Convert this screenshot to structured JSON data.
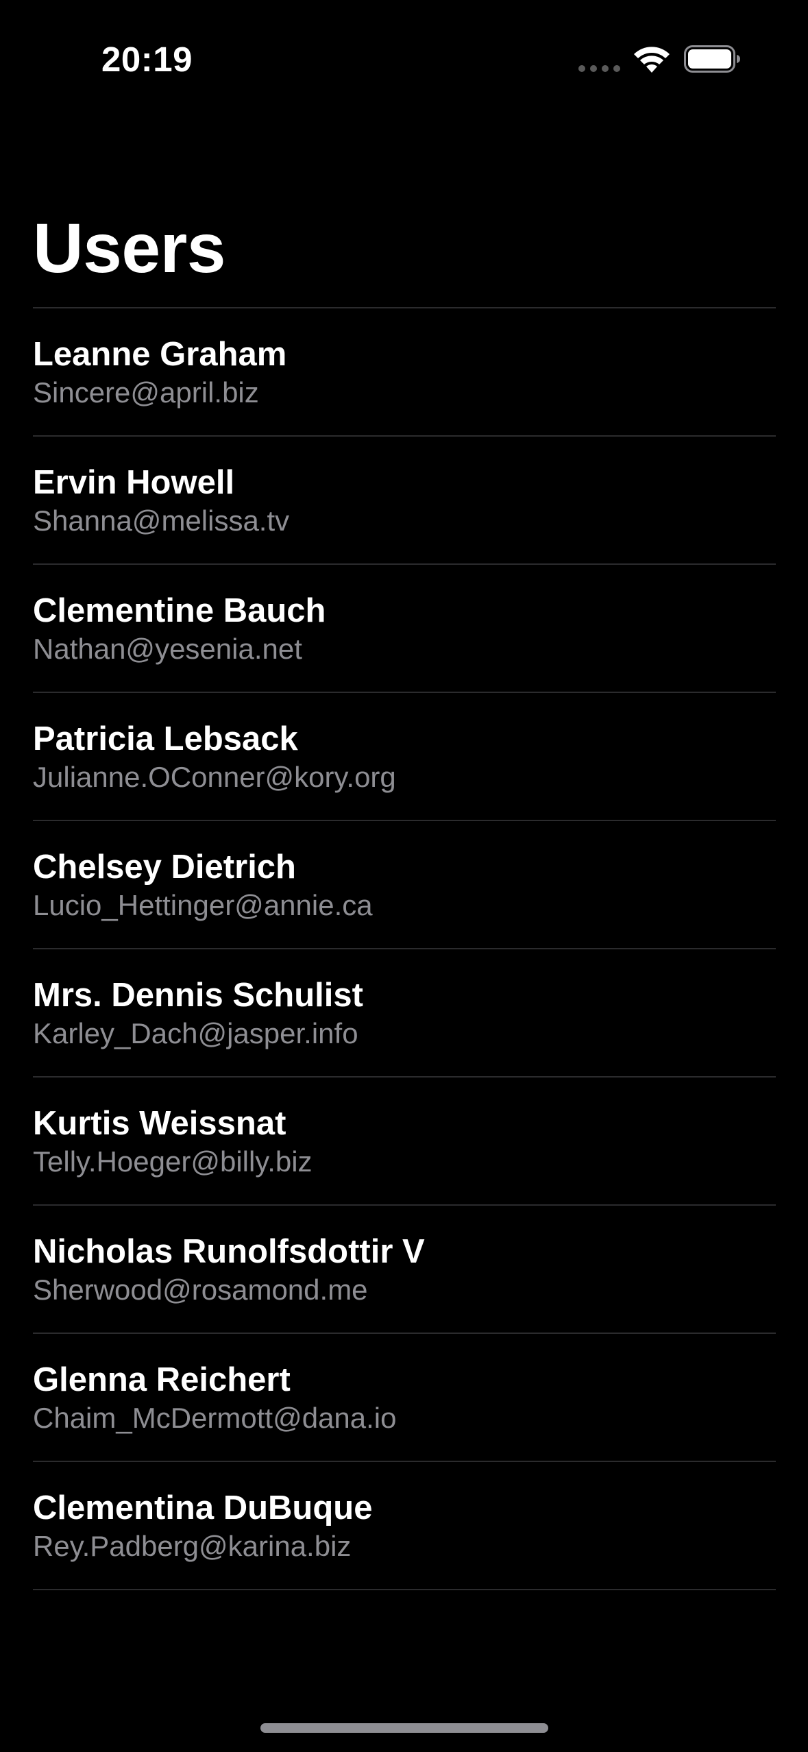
{
  "status_bar": {
    "time": "20:19",
    "icons": [
      "cellular-signal-icon",
      "wifi-icon",
      "battery-icon"
    ]
  },
  "page": {
    "title": "Users"
  },
  "users": [
    {
      "name": "Leanne Graham",
      "email": "Sincere@april.biz"
    },
    {
      "name": "Ervin Howell",
      "email": "Shanna@melissa.tv"
    },
    {
      "name": "Clementine Bauch",
      "email": "Nathan@yesenia.net"
    },
    {
      "name": "Patricia Lebsack",
      "email": "Julianne.OConner@kory.org"
    },
    {
      "name": "Chelsey Dietrich",
      "email": "Lucio_Hettinger@annie.ca"
    },
    {
      "name": "Mrs. Dennis Schulist",
      "email": "Karley_Dach@jasper.info"
    },
    {
      "name": "Kurtis Weissnat",
      "email": "Telly.Hoeger@billy.biz"
    },
    {
      "name": "Nicholas Runolfsdottir V",
      "email": "Sherwood@rosamond.me"
    },
    {
      "name": "Glenna Reichert",
      "email": "Chaim_McDermott@dana.io"
    },
    {
      "name": "Clementina DuBuque",
      "email": "Rey.Padberg@karina.biz"
    }
  ],
  "colors": {
    "background": "#000000",
    "primary_text": "#ffffff",
    "secondary_text": "#8e8e93",
    "separator": "#2b2b2d"
  }
}
